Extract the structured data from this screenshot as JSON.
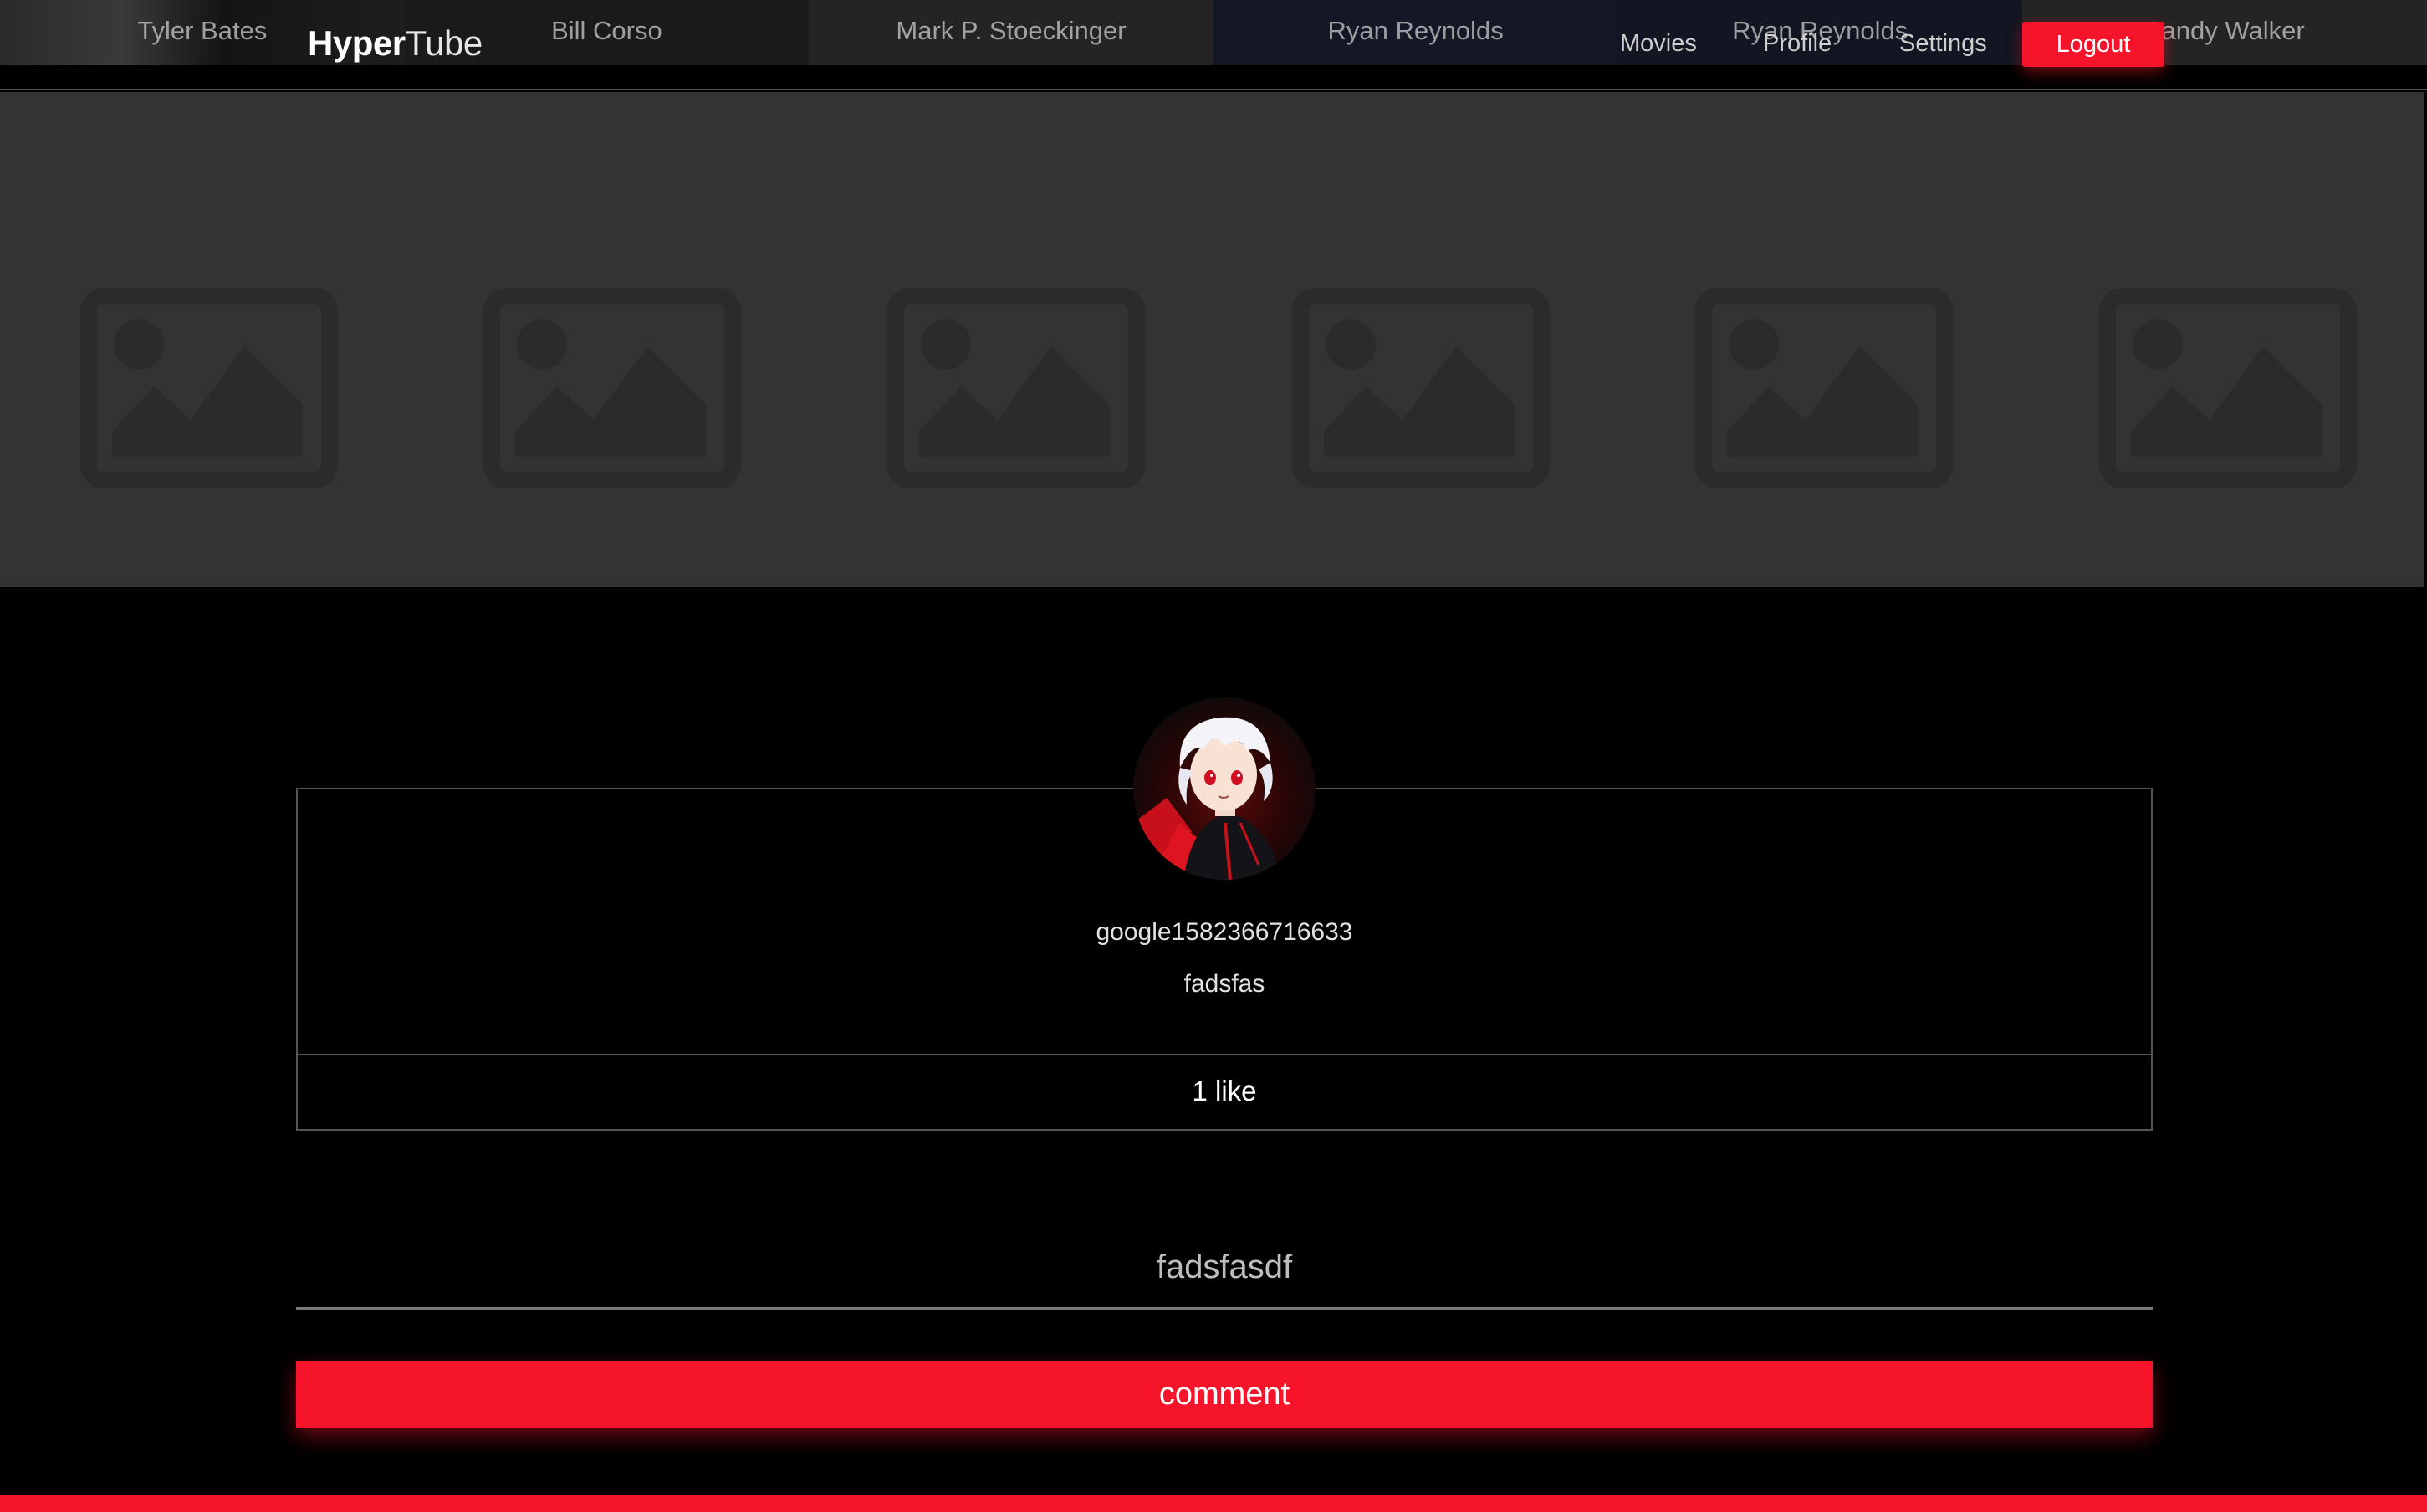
{
  "header": {
    "brand_bold": "Hyper",
    "brand_light": "Tube",
    "nav": {
      "movies": "Movies",
      "profile": "Profile",
      "settings": "Settings",
      "logout": "Logout"
    },
    "cast": [
      "Tyler Bates",
      "Bill Corso",
      "Mark P. Stoeckinger",
      "Ryan Reynolds",
      "Ryan Reynolds",
      "Sandy Walker"
    ]
  },
  "gallery": {
    "placeholder_icon": "image-placeholder-icon",
    "count": 6
  },
  "profile": {
    "avatar_icon": "anime-avatar",
    "username": "google1582366716633",
    "bio": "fadsfas",
    "likes": "1 like"
  },
  "comment_form": {
    "input_value": "fadsfasdf",
    "submit_label": "comment"
  },
  "colors": {
    "accent": "#f51429",
    "background": "#000000",
    "placeholder_bg": "#333333"
  }
}
